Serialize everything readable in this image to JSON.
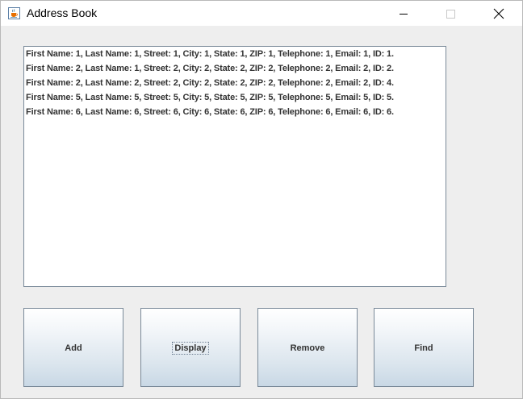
{
  "window": {
    "title": "Address Book",
    "app_icon": "java-cup-icon",
    "controls": {
      "minimize_icon": "minimize-icon",
      "maximize_icon": "maximize-icon",
      "close_icon": "close-icon"
    }
  },
  "list": {
    "rows": [
      "First Name: 1, Last Name: 1, Street: 1, City: 1, State: 1, ZIP: 1, Telephone: 1, Email: 1, ID: 1.",
      "First Name: 2, Last Name: 1, Street: 2, City: 2, State: 2, ZIP: 2, Telephone: 2, Email: 2, ID: 2.",
      "First Name: 2, Last Name: 2, Street: 2, City: 2, State: 2, ZIP: 2, Telephone: 2, Email: 2, ID: 4.",
      "First Name: 5, Last Name: 5, Street: 5, City: 5, State: 5, ZIP: 5, Telephone: 5, Email: 5, ID: 5.",
      "First Name: 6, Last Name: 6, Street: 6, City: 6, State: 6, ZIP: 6, Telephone: 6, Email: 6, ID: 6."
    ]
  },
  "buttons": {
    "add": "Add",
    "display": "Display",
    "remove": "Remove",
    "find": "Find"
  },
  "colors": {
    "button_gradient_top": "#ffffff",
    "button_gradient_bottom": "#c9d8e5",
    "button_border": "#7a8a99",
    "panel_background": "#eeeeee"
  }
}
